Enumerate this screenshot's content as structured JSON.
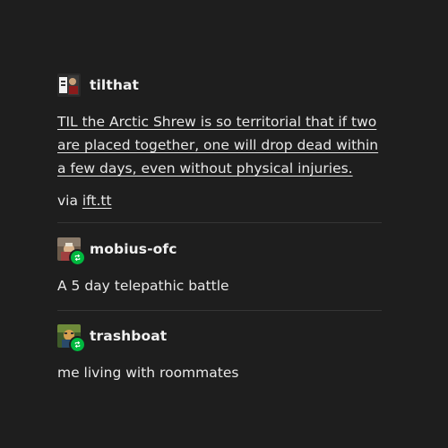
{
  "posts": [
    {
      "username": "tilthat",
      "title_link": "TIL the Arctic Shrew is so territorial that if two are placed together, one will drop dead within a few days, even without physical injuries.",
      "via_prefix": "via ",
      "via_link": "ift.tt"
    },
    {
      "username": "mobius-ofc",
      "text": "A 5 day telepathic battle"
    },
    {
      "username": "trashboat",
      "text": "me living with roommates"
    }
  ],
  "icons": {
    "reblog": "reblog-icon",
    "avatar": "avatar"
  },
  "colors": {
    "background": "#1e1e1e",
    "text": "#e8e8e8",
    "reblog_badge": "#00b83f",
    "divider": "#353535"
  }
}
